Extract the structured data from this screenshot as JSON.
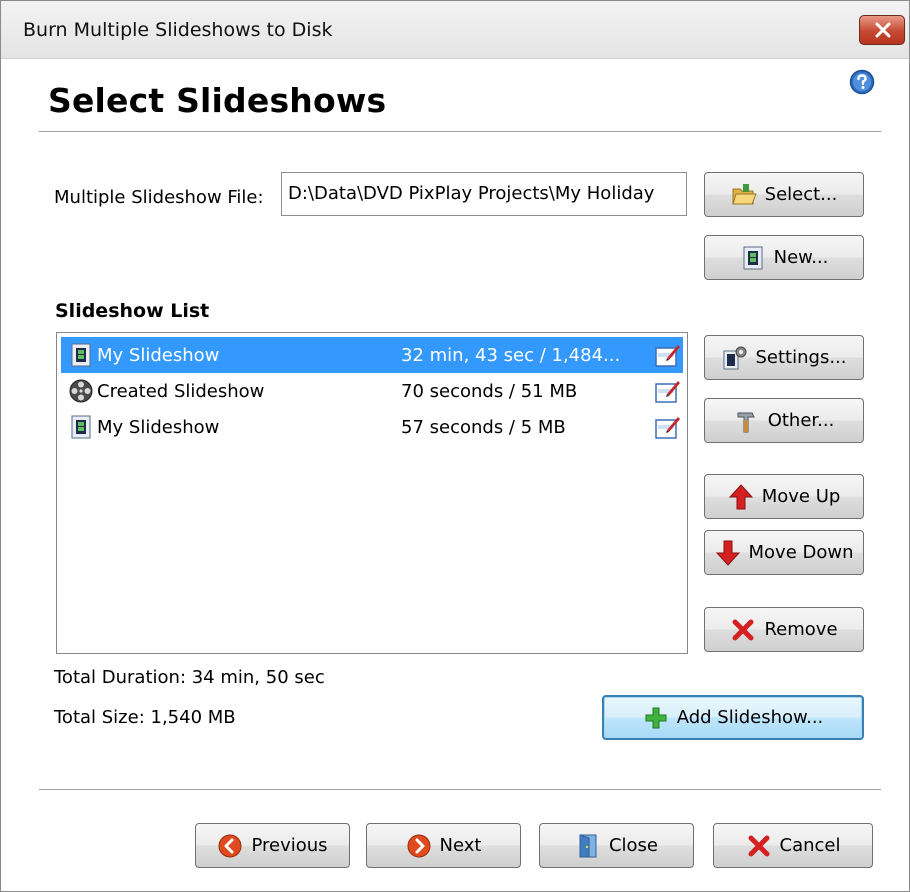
{
  "window": {
    "title": "Burn Multiple Slideshows to Disk"
  },
  "header": {
    "title": "Select Slideshows"
  },
  "file": {
    "label": "Multiple Slideshow File:",
    "value": "D:\\Data\\DVD PixPlay Projects\\My Holiday"
  },
  "buttons": {
    "select": "Select...",
    "new": "New...",
    "settings": "Settings...",
    "other": "Other...",
    "move_up": "Move Up",
    "move_down": "Move Down",
    "remove": "Remove",
    "add": "Add Slideshow...",
    "previous": "Previous",
    "next": "Next",
    "close": "Close",
    "cancel": "Cancel"
  },
  "slideshow_list": {
    "heading": "Slideshow List",
    "items": [
      {
        "name": "My Slideshow",
        "info": "32 min, 43 sec / 1,484...",
        "icon": "film-doc-icon",
        "selected": true
      },
      {
        "name": "Created Slideshow",
        "info": "70 seconds / 51 MB",
        "icon": "film-reel-icon",
        "selected": false
      },
      {
        "name": "My Slideshow",
        "info": "57 seconds / 5 MB",
        "icon": "film-doc-icon",
        "selected": false
      }
    ]
  },
  "totals": {
    "duration": "Total Duration: 34 min, 50 sec",
    "size": "Total Size: 1,540 MB"
  },
  "colors": {
    "selection": "#3399ff",
    "close_button": "#c64a33",
    "focus_border": "#3c7fb1"
  }
}
